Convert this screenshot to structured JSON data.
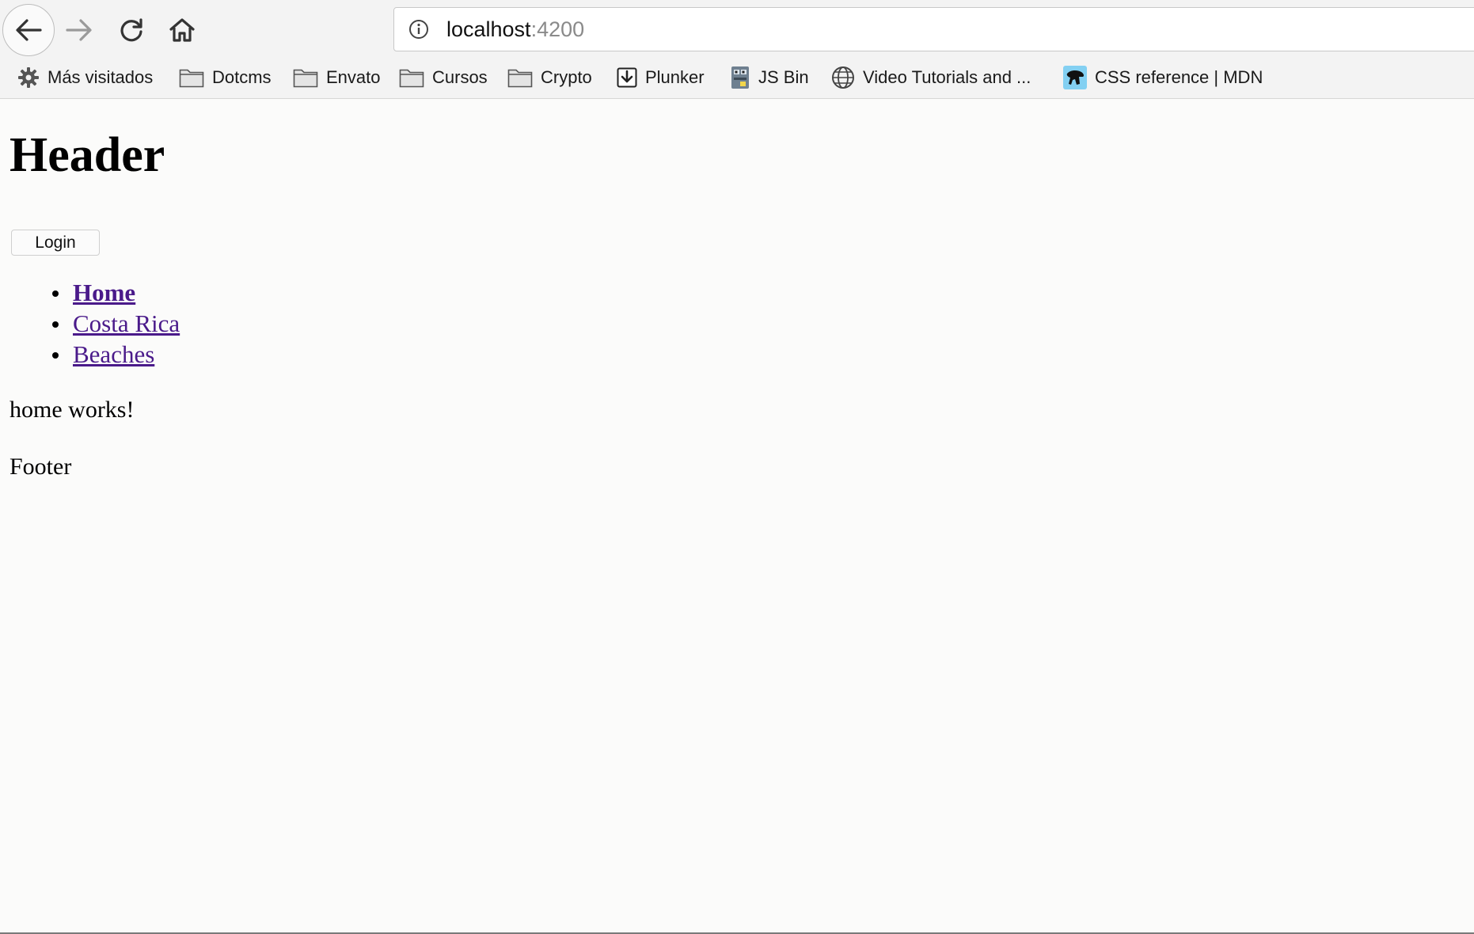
{
  "browser": {
    "url_host": "localhost",
    "url_port": ":4200",
    "bookmarks": [
      {
        "label": "Más visitados",
        "icon": "gear-icon"
      },
      {
        "label": "Dotcms",
        "icon": "folder-icon"
      },
      {
        "label": "Envato",
        "icon": "folder-icon"
      },
      {
        "label": "Cursos",
        "icon": "folder-icon"
      },
      {
        "label": "Crypto",
        "icon": "folder-icon"
      },
      {
        "label": "Plunker",
        "icon": "download-box-icon"
      },
      {
        "label": "JS Bin",
        "icon": "jsbin-icon"
      },
      {
        "label": "Video Tutorials and ...",
        "icon": "globe-icon"
      },
      {
        "label": "CSS reference | MDN",
        "icon": "mdn-dino-icon"
      }
    ]
  },
  "page": {
    "header": "Header",
    "login_label": "Login",
    "nav": [
      {
        "label": "Home",
        "active": true
      },
      {
        "label": "Costa Rica",
        "active": false
      },
      {
        "label": "Beaches",
        "active": false
      }
    ],
    "content": "home works!",
    "footer": "Footer"
  },
  "colors": {
    "link": "#4a1a8a",
    "background": "#fbfbfa",
    "chrome": "#f3f3f3"
  }
}
